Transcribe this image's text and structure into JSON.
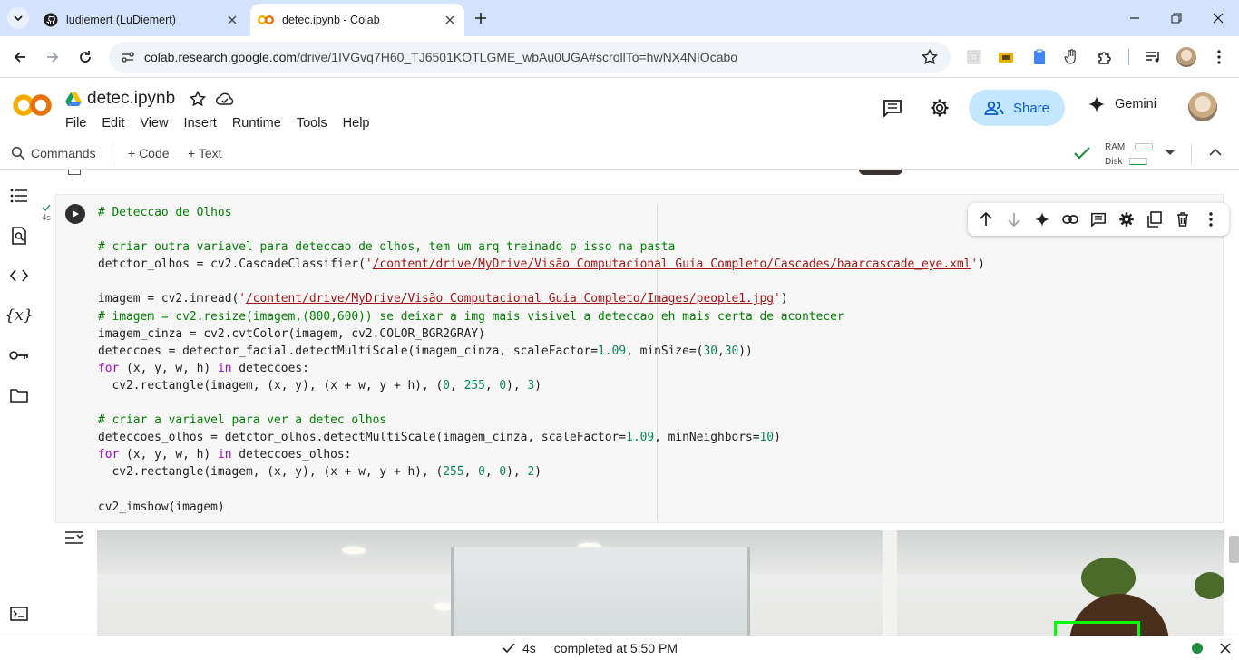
{
  "browser": {
    "tabs": [
      {
        "title": "ludiemert (LuDiemert)",
        "icon": "github-icon",
        "active": false
      },
      {
        "title": "detec.ipynb - Colab",
        "icon": "colab-icon",
        "active": true
      }
    ],
    "url_host": "colab.research.google.com",
    "url_path": "/drive/1IVGvq7H60_TJ6501KOTLGME_wbAu0UGA#scrollTo=hwNX4NIOcabo"
  },
  "colab": {
    "notebook_title": "detec.ipynb",
    "menu": [
      "File",
      "Edit",
      "View",
      "Insert",
      "Runtime",
      "Tools",
      "Help"
    ],
    "share_label": "Share",
    "gemini_label": "Gemini"
  },
  "toolbar": {
    "commands_label": "Commands",
    "code_label": "+ Code",
    "text_label": "+ Text",
    "ram_label": "RAM",
    "disk_label": "Disk"
  },
  "cell": {
    "exec_time": "4s",
    "code_lines": [
      [
        [
          "c-cm",
          "# Deteccao de Olhos"
        ]
      ],
      [],
      [
        [
          "c-cm",
          "# criar outra variavel para deteccao de olhos, tem um arq treinado p isso na pasta"
        ]
      ],
      [
        [
          "",
          "detctor_olhos = cv2.CascadeClassifier("
        ],
        [
          "c-st",
          "'"
        ],
        [
          "c-st st-u",
          "/content/drive/MyDrive/Visão Computacional Guia Completo/Cascades/haarcascade_eye.xml"
        ],
        [
          "c-st",
          "'"
        ],
        [
          "",
          ")"
        ]
      ],
      [],
      [
        [
          "",
          "imagem = cv2.imread("
        ],
        [
          "c-st",
          "'"
        ],
        [
          "c-st st-u",
          "/content/drive/MyDrive/Visão Computacional Guia Completo/Images/people1.jpg"
        ],
        [
          "c-st",
          "'"
        ],
        [
          "",
          ")"
        ]
      ],
      [
        [
          "c-cm",
          "# imagem = cv2.resize(imagem,(800,600)) se deixar a img mais visivel a deteccao eh mais certa de acontecer"
        ]
      ],
      [
        [
          "",
          "imagem_cinza = cv2.cvtColor(imagem, cv2.COLOR_BGR2GRAY)"
        ]
      ],
      [
        [
          "",
          "deteccoes = detector_facial.detectMultiScale(imagem_cinza, scaleFactor="
        ],
        [
          "c-nu",
          "1.09"
        ],
        [
          "",
          ", minSize=("
        ],
        [
          "c-nu",
          "30"
        ],
        [
          "",
          ","
        ],
        [
          "c-nu",
          "30"
        ],
        [
          "",
          "))"
        ]
      ],
      [
        [
          "c-kw",
          "for"
        ],
        [
          "",
          " (x, y, w, h) "
        ],
        [
          "c-kw",
          "in"
        ],
        [
          "",
          " deteccoes:"
        ]
      ],
      [
        [
          "",
          "  cv2.rectangle(imagem, (x, y), (x + w, y + h), ("
        ],
        [
          "c-nu",
          "0"
        ],
        [
          "",
          ", "
        ],
        [
          "c-nu",
          "255"
        ],
        [
          "",
          ", "
        ],
        [
          "c-nu",
          "0"
        ],
        [
          "",
          "), "
        ],
        [
          "c-nu",
          "3"
        ],
        [
          "",
          ")"
        ]
      ],
      [],
      [
        [
          "c-cm",
          "# criar a variavel para ver a detec olhos"
        ]
      ],
      [
        [
          "",
          "deteccoes_olhos = detctor_olhos.detectMultiScale(imagem_cinza, scaleFactor="
        ],
        [
          "c-nu",
          "1.09"
        ],
        [
          "",
          ", minNeighbors="
        ],
        [
          "c-nu",
          "10"
        ],
        [
          "",
          ")"
        ]
      ],
      [
        [
          "c-kw",
          "for"
        ],
        [
          "",
          " (x, y, w, h) "
        ],
        [
          "c-kw",
          "in"
        ],
        [
          "",
          " deteccoes_olhos:"
        ]
      ],
      [
        [
          "",
          "  cv2.rectangle(imagem, (x, y), (x + w, y + h), ("
        ],
        [
          "c-nu",
          "255"
        ],
        [
          "",
          ", "
        ],
        [
          "c-nu",
          "0"
        ],
        [
          "",
          ", "
        ],
        [
          "c-nu",
          "0"
        ],
        [
          "",
          "), "
        ],
        [
          "c-nu",
          "2"
        ],
        [
          "",
          ")"
        ]
      ],
      [],
      [
        [
          "",
          "cv2_imshow(imagem)"
        ]
      ]
    ]
  },
  "status": {
    "time": "4s",
    "text": "completed at 5:50 PM"
  },
  "colors": {
    "accent": "#0b57d0",
    "share_bg": "#c2e7ff",
    "tabbar_bg": "#d3e3fd",
    "ok_green": "#1e8e3e"
  }
}
